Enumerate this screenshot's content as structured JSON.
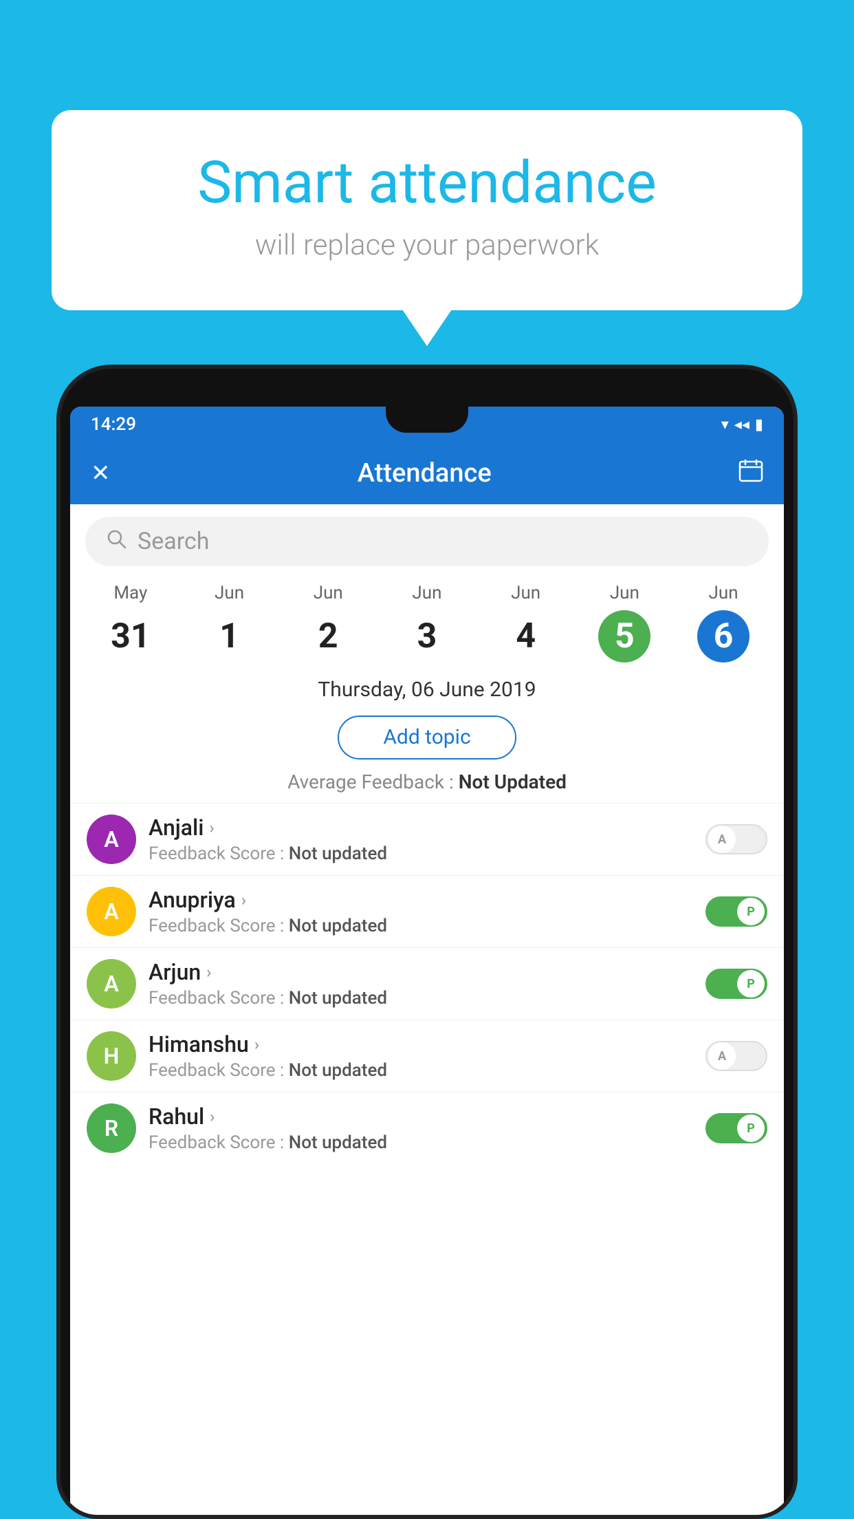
{
  "background_color": "#1BB8E8",
  "speech_bubble": {
    "title": "Smart attendance",
    "subtitle": "will replace your paperwork"
  },
  "status_bar": {
    "time": "14:29",
    "wifi_icon": "▾",
    "signal_icon": "◂",
    "battery_icon": "▮"
  },
  "app_bar": {
    "title": "Attendance",
    "close_label": "✕",
    "calendar_label": "📅"
  },
  "search": {
    "placeholder": "Search"
  },
  "calendar": {
    "days": [
      {
        "month": "May",
        "date": "31",
        "type": "normal"
      },
      {
        "month": "Jun",
        "date": "1",
        "type": "normal"
      },
      {
        "month": "Jun",
        "date": "2",
        "type": "normal"
      },
      {
        "month": "Jun",
        "date": "3",
        "type": "normal"
      },
      {
        "month": "Jun",
        "date": "4",
        "type": "normal"
      },
      {
        "month": "Jun",
        "date": "5",
        "type": "today"
      },
      {
        "month": "Jun",
        "date": "6",
        "type": "selected"
      }
    ],
    "selected_date": "Thursday, 06 June 2019"
  },
  "add_topic_label": "Add topic",
  "avg_feedback": {
    "label": "Average Feedback : ",
    "value": "Not Updated"
  },
  "students": [
    {
      "name": "Anjali",
      "avatar_letter": "A",
      "avatar_color": "#9C27B0",
      "feedback_label": "Feedback Score : ",
      "feedback_value": "Not updated",
      "present": false,
      "toggle_letter": "A"
    },
    {
      "name": "Anupriya",
      "avatar_letter": "A",
      "avatar_color": "#FFC107",
      "feedback_label": "Feedback Score : ",
      "feedback_value": "Not updated",
      "present": true,
      "toggle_letter": "P"
    },
    {
      "name": "Arjun",
      "avatar_letter": "A",
      "avatar_color": "#8BC34A",
      "feedback_label": "Feedback Score : ",
      "feedback_value": "Not updated",
      "present": true,
      "toggle_letter": "P"
    },
    {
      "name": "Himanshu",
      "avatar_letter": "H",
      "avatar_color": "#8BC34A",
      "feedback_label": "Feedback Score : ",
      "feedback_value": "Not updated",
      "present": false,
      "toggle_letter": "A"
    },
    {
      "name": "Rahul",
      "avatar_letter": "R",
      "avatar_color": "#4CAF50",
      "feedback_label": "Feedback Score : ",
      "feedback_value": "Not updated",
      "present": true,
      "toggle_letter": "P"
    }
  ]
}
